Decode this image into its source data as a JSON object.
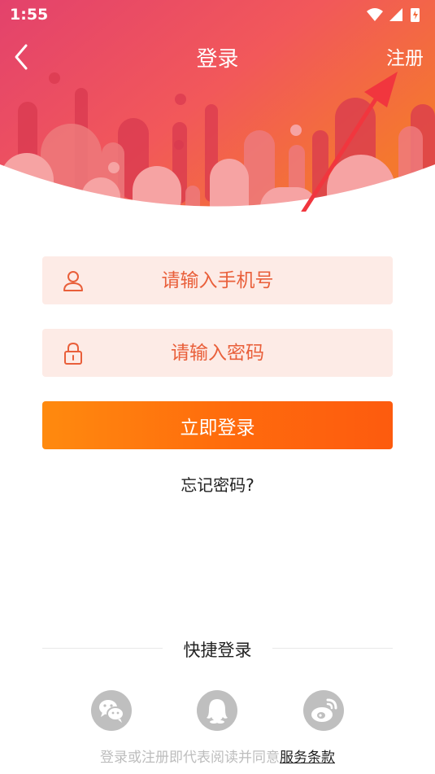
{
  "status_bar": {
    "time": "1:55"
  },
  "nav": {
    "title": "登录",
    "register_label": "注册"
  },
  "form": {
    "phone_placeholder": "请输入手机号",
    "password_placeholder": "请输入密码",
    "login_label": "立即登录",
    "forgot_label": "忘记密码?"
  },
  "quick_login": {
    "title": "快捷登录",
    "options": [
      "wechat-icon",
      "qq-icon",
      "weibo-icon"
    ]
  },
  "agreement": {
    "prefix": "登录或注册即代表阅读并同意",
    "link": "服务条款"
  },
  "colors": {
    "header_gradient_start": "#e6456a",
    "header_gradient_end": "#f26b3a",
    "field_bg": "#fdebe6",
    "accent_text": "#e95f3a",
    "button_start": "#ff8a0e",
    "button_end": "#fd5b0e"
  }
}
